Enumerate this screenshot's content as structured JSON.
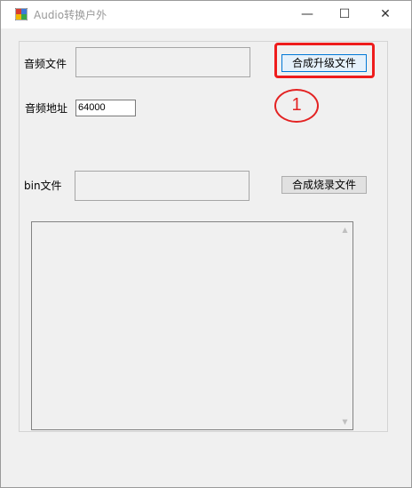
{
  "window": {
    "title": "Audio转换户外",
    "minimize_glyph": "—",
    "maximize_glyph": "☐",
    "close_glyph": "✕"
  },
  "form": {
    "audio_file_label": "音频文件",
    "audio_file_value": "",
    "merge_upgrade_button": "合成升级文件",
    "audio_address_label": "音频地址",
    "audio_address_value": "64000",
    "bin_file_label": "bin文件",
    "bin_file_value": "",
    "merge_burn_button": "合成烧录文件",
    "log_text": ""
  },
  "annotation": {
    "step_number": "1",
    "color": "#ee1c1c"
  },
  "icons": [
    "app-icon",
    "minimize-icon",
    "maximize-icon",
    "close-icon",
    "scroll-up-icon",
    "scroll-down-icon"
  ]
}
